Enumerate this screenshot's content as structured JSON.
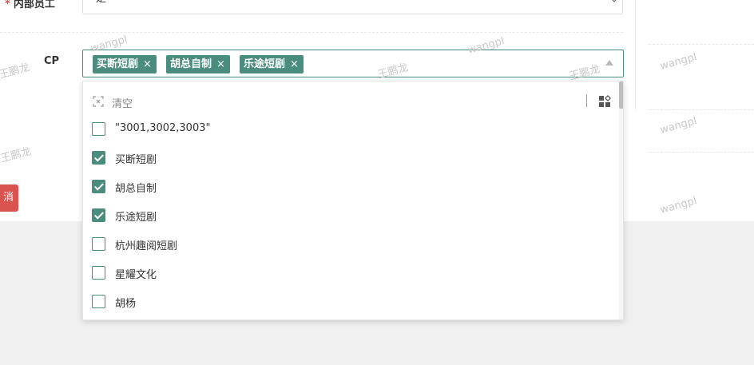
{
  "form": {
    "internal_staff": {
      "label": "内部员工",
      "value": "是"
    },
    "cp": {
      "label": "CP",
      "tags": [
        "买断短剧",
        "胡总自制",
        "乐途短剧"
      ],
      "tag_close": "×"
    }
  },
  "dropdown": {
    "clear_label": "清空",
    "options": [
      {
        "label": "\"3001,3002,3003\"",
        "checked": false
      },
      {
        "label": "买断短剧",
        "checked": true
      },
      {
        "label": "胡总自制",
        "checked": true
      },
      {
        "label": "乐途短剧",
        "checked": true
      },
      {
        "label": "杭州趣阅短剧",
        "checked": false
      },
      {
        "label": "星耀文化",
        "checked": false
      },
      {
        "label": "胡杨",
        "checked": false
      }
    ]
  },
  "actions": {
    "cancel_label": "消"
  },
  "watermarks": [
    "wangpl",
    "王鹏龙",
    "wangpl",
    "王鹏龙",
    "wangpl",
    "王鹏龙",
    "wangpl",
    "wangpl",
    "wangpl",
    "王鹏龙"
  ],
  "colors": {
    "accent": "#4a8c7d",
    "danger": "#d9534f",
    "required": "#d9534f"
  }
}
